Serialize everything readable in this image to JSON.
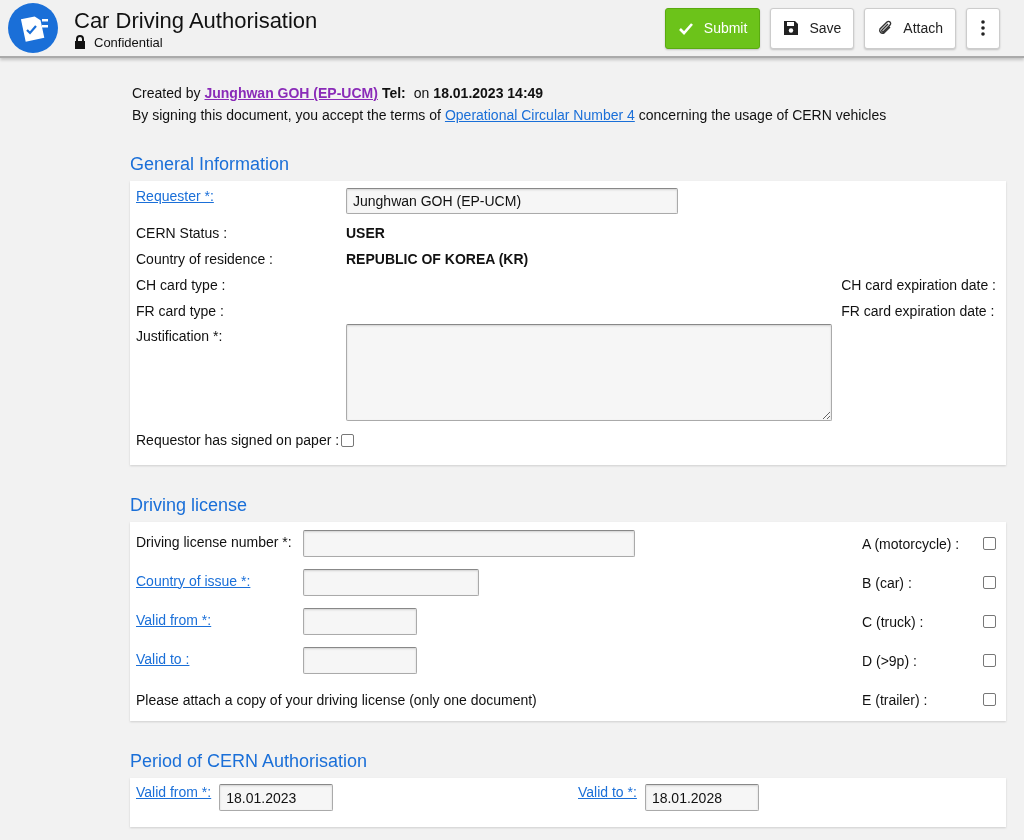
{
  "header": {
    "title": "Car Driving Authorisation",
    "subtitle": "Confidential",
    "buttons": [
      {
        "kind": "submit",
        "label": "Submit"
      },
      {
        "kind": "save",
        "label": "Save"
      },
      {
        "kind": "attach",
        "label": "Attach"
      },
      {
        "kind": "more"
      }
    ]
  },
  "intro": {
    "created_by": "Created by",
    "author": "Junghwan GOH (EP-UCM)",
    "tel_label": "Tel:",
    "on_label": "on",
    "date": "18.01.2023 14:49",
    "terms_before": "By signing this document, you accept the terms of",
    "terms_link": "Operational Circular Number 4",
    "terms_after": "concerning the usage of CERN vehicles"
  },
  "general_information": {
    "title": "General Information",
    "rows": [
      {
        "kind": "input",
        "label": "Requester *:",
        "link": true,
        "value": "Junghwan GOH (EP-UCM)"
      },
      {
        "kind": "value",
        "label": "CERN Status :",
        "link": false,
        "value": "USER"
      },
      {
        "kind": "value",
        "label": "Country of residence :",
        "link": false,
        "value": "REPUBLIC OF KOREA (KR)"
      },
      {
        "kind": "pair",
        "label": "CH card type :",
        "link": false,
        "right_label": "CH card expiration date :"
      },
      {
        "kind": "pair",
        "label": "FR card type :",
        "link": false,
        "right_label": "FR card expiration date :"
      },
      {
        "kind": "textarea",
        "label": "Justification *:",
        "link": false
      },
      {
        "kind": "checkbox",
        "label": "Requestor has signed on paper :",
        "link": false,
        "checked": false
      }
    ]
  },
  "driving_license": {
    "title": "Driving license",
    "fields": [
      {
        "label": "Driving license number *:",
        "link": false,
        "kind": "wide"
      },
      {
        "label": "Country of issue *:",
        "link": true,
        "kind": "medium"
      },
      {
        "label": "Valid from *:",
        "link": true,
        "kind": "narrow"
      },
      {
        "label": "Valid to :",
        "link": true,
        "kind": "narrow"
      }
    ],
    "note": "Please attach a copy of your driving license (only one document)",
    "categories": [
      {
        "label": "A (motorcycle) :",
        "checked": false
      },
      {
        "label": "B (car) :",
        "checked": false
      },
      {
        "label": "C (truck) :",
        "checked": false
      },
      {
        "label": "D (>9p) :",
        "checked": false
      },
      {
        "label": "E (trailer) :",
        "checked": false
      }
    ]
  },
  "period": {
    "title": "Period of CERN Authorisation",
    "fields": [
      {
        "label": "Valid from *:",
        "value": "18.01.2023"
      },
      {
        "label": "Valid to *:",
        "value": "18.01.2028"
      }
    ]
  }
}
